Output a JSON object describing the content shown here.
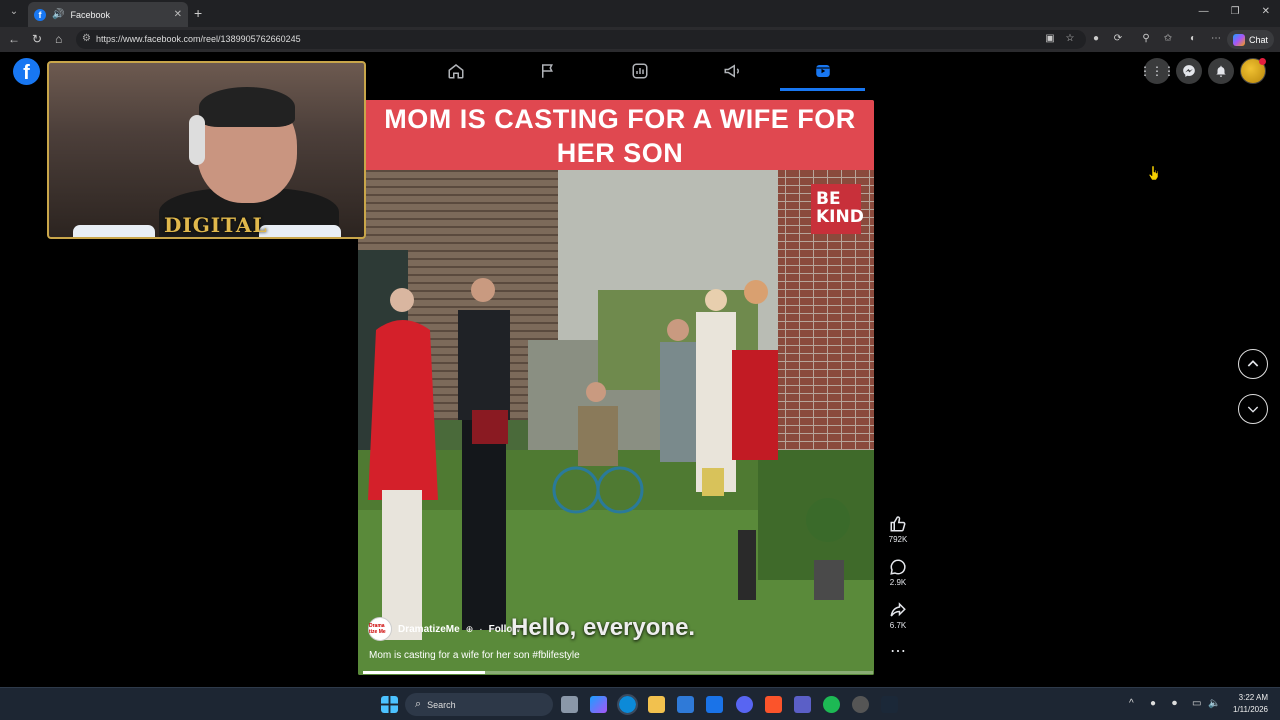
{
  "browser": {
    "tab_title": "Facebook",
    "url": "https://www.facebook.com/reel/1389905762660245",
    "chat_label": "Chat"
  },
  "fb": {
    "logo": "f",
    "nav_icons": [
      "home-icon",
      "flag-icon",
      "dashboard-icon",
      "megaphone-icon",
      "reels-icon"
    ],
    "right_icons": [
      "menu-grid-icon",
      "messenger-icon",
      "bell-icon"
    ]
  },
  "webcam": {
    "overlay_text": "DIGITAL"
  },
  "reel": {
    "title": "MOM IS CASTING FOR A WIFE FOR HER SON",
    "sign_text": "BE KIND",
    "author": "DramatizeMe",
    "author_avatar_text": "Drama tize Me",
    "separator": "·",
    "follow": "Follow",
    "subtitle": "Hello, everyone.",
    "caption": "Mom is casting for a wife for her son #fblifestyle",
    "progress": 0.24
  },
  "actions": {
    "likes": "792K",
    "comments": "2.9K",
    "shares": "6.7K"
  },
  "taskbar": {
    "search_label": "Search",
    "time": "3:22 AM",
    "date": "1/11/2026"
  },
  "colors": {
    "fb_blue": "#1877f2",
    "title_banner": "#e04850",
    "be_kind": "#c8303a"
  }
}
